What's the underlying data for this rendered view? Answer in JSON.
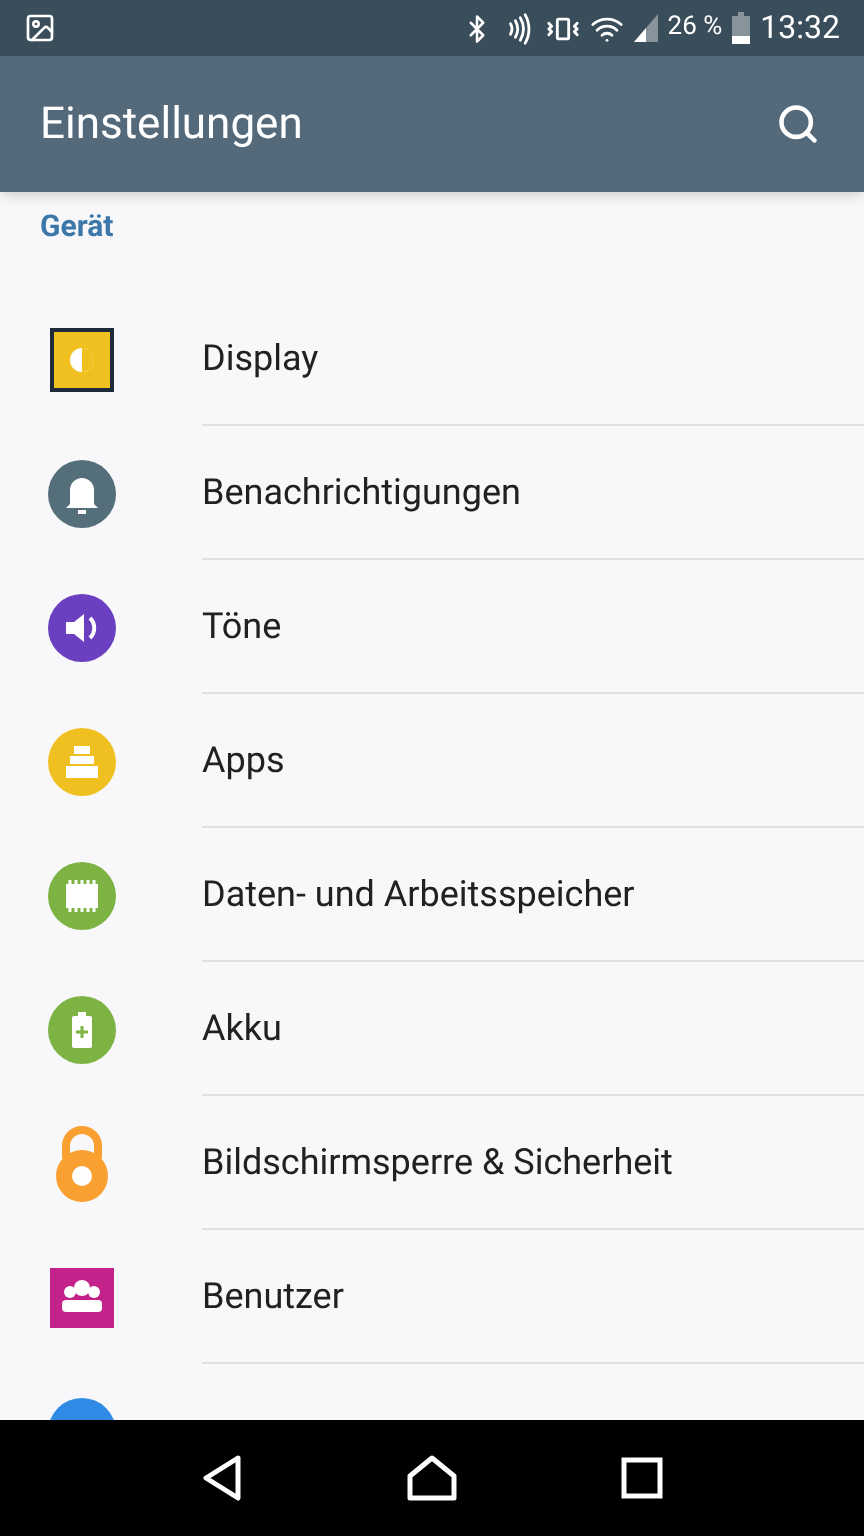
{
  "status_bar": {
    "battery_text": "26 %",
    "time": "13:32"
  },
  "app_bar": {
    "title": "Einstellungen"
  },
  "section": {
    "title": "Gerät"
  },
  "items": [
    {
      "kind": "display",
      "label": "Display",
      "color": "#f0c020"
    },
    {
      "kind": "bell",
      "label": "Benachrichtigungen",
      "color": "#546e7a"
    },
    {
      "kind": "speaker",
      "label": "Töne",
      "color": "#6a3fc0"
    },
    {
      "kind": "apps",
      "label": "Apps",
      "color": "#f0c020"
    },
    {
      "kind": "memory",
      "label": "Daten- und Arbeitsspeicher",
      "color": "#7cb342"
    },
    {
      "kind": "battery",
      "label": "Akku",
      "color": "#7cb342"
    },
    {
      "kind": "lock",
      "label": "Bildschirmsperre & Sicherheit",
      "color": "#f9a030"
    },
    {
      "kind": "users",
      "label": "Benutzer",
      "color": "#c2228a"
    },
    {
      "kind": "circle",
      "color": "#2f8be6"
    }
  ]
}
